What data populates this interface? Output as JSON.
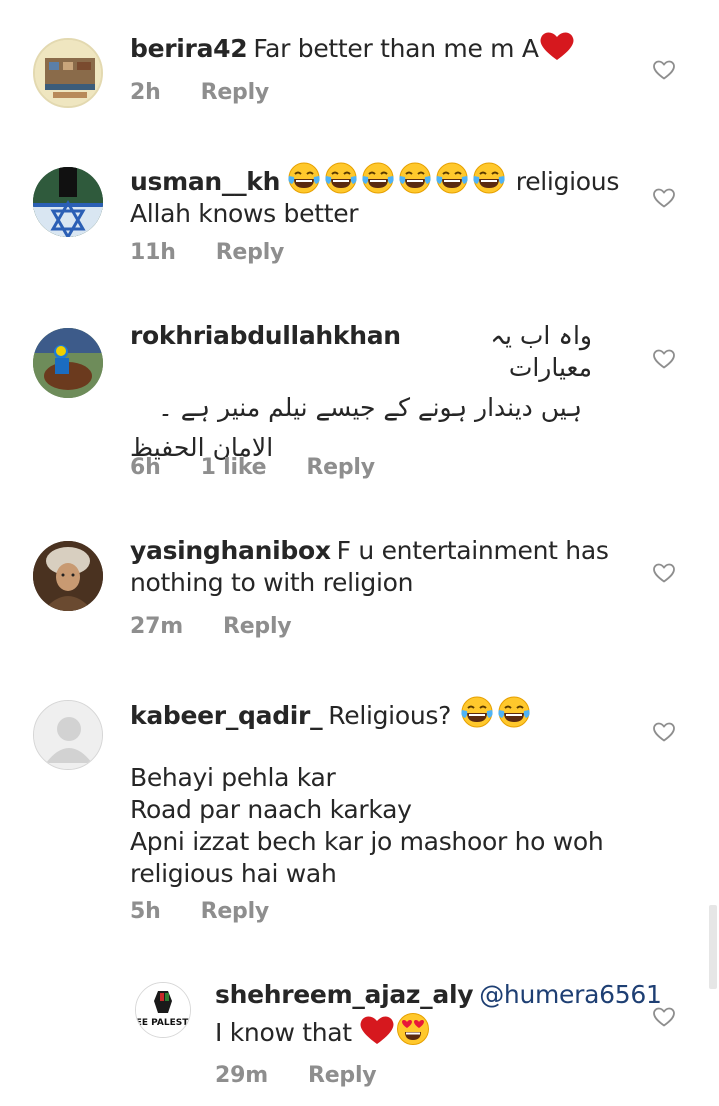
{
  "comments": [
    {
      "username": "berira42",
      "text": "Far better than me m A",
      "time": "2h",
      "likes": "",
      "reply": "Reply"
    },
    {
      "username": "usman__kh",
      "text_after": "religious",
      "text_line2": "Allah knows better",
      "time": "11h",
      "reply": "Reply"
    },
    {
      "username": "rokhriabdullahkhan",
      "text_line1": "واہ اب یہ معیارات",
      "text_line2": "ہیں دیندار ہونے کے جیسے نیلم منیر ہے ۔",
      "text_line3": "الامان الحفیظ",
      "time": "6h",
      "likes": "1 like",
      "reply": "Reply"
    },
    {
      "username": "yasinghanibox",
      "text_line1": "F u  entertainment has",
      "text_line2": "nothing to with religion",
      "time": "27m",
      "reply": "Reply"
    },
    {
      "username": "kabeer_qadir_",
      "text_line1": "Religious?",
      "text_line2": "Behayi pehla kar",
      "text_line3": "Road par naach karkay",
      "text_line4": "Apni izzat bech kar jo mashoor ho woh",
      "text_line5": "religious hai wah",
      "time": "5h",
      "reply": "Reply"
    },
    {
      "username": "shehreem_ajaz_aly",
      "mention": "@humera6561",
      "text_line2": "I know that",
      "time": "29m",
      "reply": "Reply",
      "avatar_text": "FREE PALESTINE"
    }
  ],
  "icons": {
    "like": "heart-outline-icon",
    "laugh": "tears-of-joy-emoji",
    "love": "red-heart-emoji",
    "heart_eyes": "heart-eyes-emoji"
  },
  "colors": {
    "username": "#262626",
    "meta": "#8e8e8e",
    "mention": "#1e3f73",
    "red_heart": "#d6181e"
  }
}
